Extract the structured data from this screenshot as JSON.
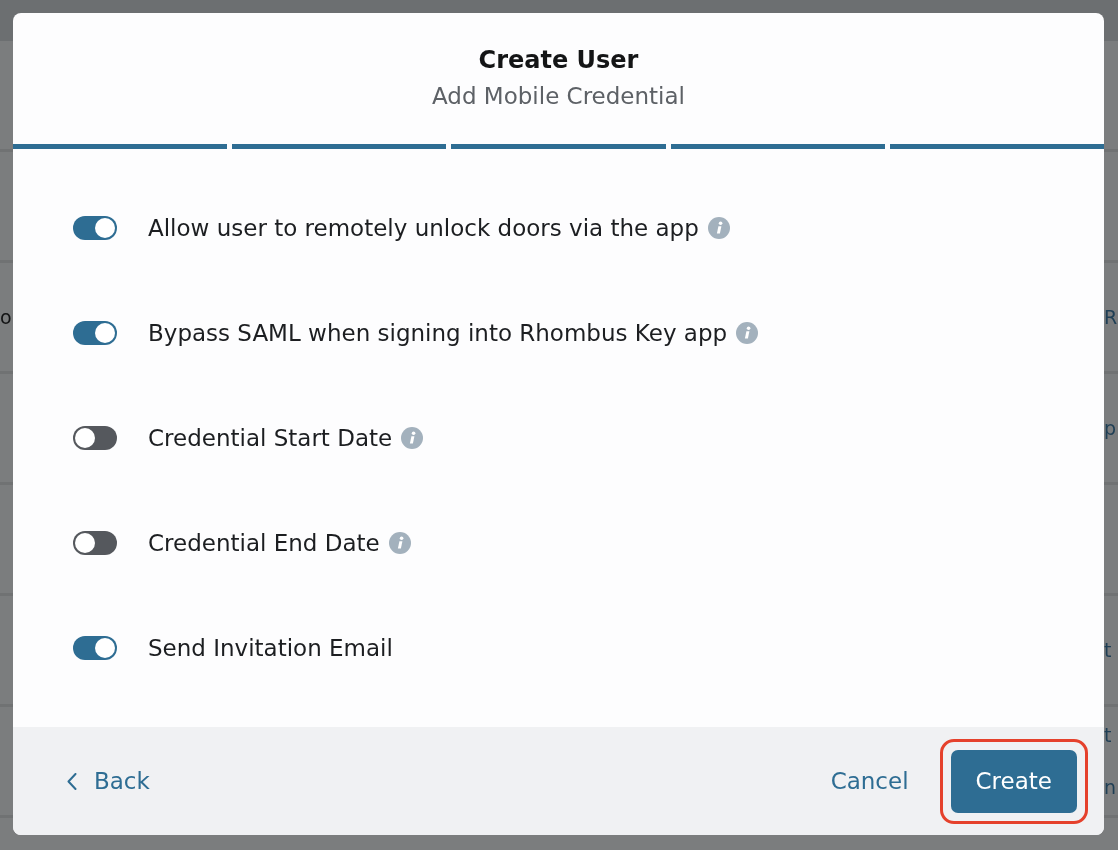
{
  "background_table": {
    "rows": [
      {},
      {},
      {
        "left": "o",
        "right": [
          "R"
        ]
      },
      {
        "right": [
          "p"
        ]
      },
      {},
      {
        "right": [
          "t"
        ]
      },
      {
        "right": [
          "t",
          "n"
        ]
      }
    ]
  },
  "dialog": {
    "title": "Create User",
    "subtitle": "Add Mobile Credential",
    "steps": [
      {
        "complete": true
      },
      {
        "complete": true
      },
      {
        "complete": true
      },
      {
        "complete": true
      },
      {
        "complete": true
      }
    ],
    "options": [
      {
        "label": "Allow user to remotely unlock doors via the app",
        "on": true,
        "info": true
      },
      {
        "label": "Bypass SAML when signing into Rhombus Key app",
        "on": true,
        "info": true
      },
      {
        "label": "Credential Start Date",
        "on": false,
        "info": true
      },
      {
        "label": "Credential End Date",
        "on": false,
        "info": true
      },
      {
        "label": "Send Invitation Email",
        "on": true,
        "info": false
      }
    ],
    "footer": {
      "back": {
        "label": "Back"
      },
      "cancel": {
        "label": "Cancel"
      },
      "create": {
        "label": "Create",
        "highlighted": true
      }
    }
  }
}
